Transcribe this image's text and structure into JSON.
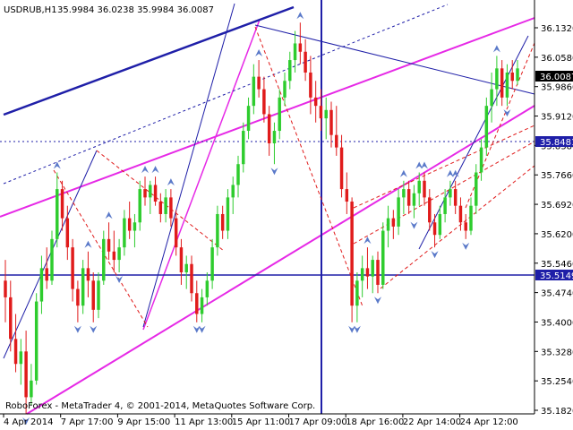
{
  "chart_data": {
    "type": "candlestick",
    "title": "USDRUB,H1",
    "ohlc_header": [
      "35.9984",
      "36.0238",
      "35.9984",
      "36.0087"
    ],
    "credit": "RoboForex - MetaTrader 4, © 2001-2014, MetaQuotes Software Corp.",
    "x_ticks": [
      "4 Apr 2014",
      "7 Apr 17:00",
      "9 Apr 15:00",
      "11 Apr 13:00",
      "15 Apr 11:00",
      "17 Apr 09:00",
      "18 Apr 16:00",
      "22 Apr 14:00",
      "24 Apr 12:00"
    ],
    "y_ticks": [
      "36.1320",
      "36.0580",
      "35.9860",
      "35.9120",
      "35.8380",
      "35.7660",
      "35.6920",
      "35.6200",
      "35.5460",
      "35.4740",
      "35.4000",
      "35.3280",
      "35.2540",
      "35.1820"
    ],
    "ylim": [
      35.18,
      36.17
    ],
    "price_markers": [
      {
        "value": "36.0087",
        "color": "#000000"
      },
      {
        "value": "35.8481",
        "color": "#1f1fa8"
      },
      {
        "value": "35.5149",
        "color": "#1f1fa8"
      }
    ],
    "colors": {
      "bull": "#2ecc2e",
      "bear": "#e01b1b",
      "channel": "#e629e6",
      "trend": "#1f1fa8",
      "fractal": "#5a79c9",
      "grid_dotted": "#1f1fa8"
    },
    "candles": [
      [
        35.5,
        35.55,
        35.4,
        35.46
      ],
      [
        35.46,
        35.5,
        35.33,
        35.36
      ],
      [
        35.36,
        35.42,
        35.28,
        35.3
      ],
      [
        35.3,
        35.36,
        35.25,
        35.33
      ],
      [
        35.33,
        35.38,
        35.18,
        35.22
      ],
      [
        35.22,
        35.3,
        35.2,
        35.26
      ],
      [
        35.26,
        35.47,
        35.25,
        35.45
      ],
      [
        35.45,
        35.56,
        35.42,
        35.53
      ],
      [
        35.53,
        35.58,
        35.48,
        35.5
      ],
      [
        35.5,
        35.62,
        35.49,
        35.6
      ],
      [
        35.6,
        35.76,
        35.58,
        35.72
      ],
      [
        35.72,
        35.74,
        35.62,
        35.65
      ],
      [
        35.65,
        35.68,
        35.55,
        35.58
      ],
      [
        35.58,
        35.6,
        35.45,
        35.48
      ],
      [
        35.48,
        35.5,
        35.4,
        35.44
      ],
      [
        35.44,
        35.55,
        35.42,
        35.53
      ],
      [
        35.53,
        35.57,
        35.46,
        35.5
      ],
      [
        35.5,
        35.52,
        35.4,
        35.43
      ],
      [
        35.43,
        35.52,
        35.41,
        35.5
      ],
      [
        35.5,
        35.62,
        35.49,
        35.6
      ],
      [
        35.6,
        35.64,
        35.55,
        35.57
      ],
      [
        35.57,
        35.62,
        35.52,
        35.55
      ],
      [
        35.55,
        35.6,
        35.52,
        35.58
      ],
      [
        35.58,
        35.67,
        35.56,
        35.65
      ],
      [
        35.65,
        35.69,
        35.6,
        35.62
      ],
      [
        35.62,
        35.66,
        35.58,
        35.64
      ],
      [
        35.64,
        35.74,
        35.62,
        35.72
      ],
      [
        35.72,
        35.75,
        35.68,
        35.7
      ],
      [
        35.7,
        35.74,
        35.66,
        35.73
      ],
      [
        35.73,
        35.75,
        35.68,
        35.69
      ],
      [
        35.69,
        35.71,
        35.64,
        35.66
      ],
      [
        35.66,
        35.72,
        35.64,
        35.7
      ],
      [
        35.7,
        35.72,
        35.63,
        35.65
      ],
      [
        35.65,
        35.67,
        35.56,
        35.58
      ],
      [
        35.58,
        35.6,
        35.49,
        35.52
      ],
      [
        35.52,
        35.56,
        35.48,
        35.54
      ],
      [
        35.54,
        35.56,
        35.45,
        35.47
      ],
      [
        35.47,
        35.5,
        35.4,
        35.42
      ],
      [
        35.42,
        35.48,
        35.4,
        35.46
      ],
      [
        35.46,
        35.52,
        35.44,
        35.5
      ],
      [
        35.5,
        35.6,
        35.48,
        35.58
      ],
      [
        35.58,
        35.68,
        35.56,
        35.66
      ],
      [
        35.66,
        35.68,
        35.6,
        35.62
      ],
      [
        35.62,
        35.72,
        35.6,
        35.7
      ],
      [
        35.7,
        35.75,
        35.66,
        35.73
      ],
      [
        35.73,
        35.8,
        35.7,
        35.78
      ],
      [
        35.78,
        35.88,
        35.76,
        35.86
      ],
      [
        35.86,
        35.94,
        35.84,
        35.92
      ],
      [
        35.92,
        36.02,
        35.9,
        35.99
      ],
      [
        35.99,
        36.03,
        35.94,
        35.96
      ],
      [
        35.96,
        35.99,
        35.88,
        35.9
      ],
      [
        35.9,
        35.92,
        35.8,
        35.83
      ],
      [
        35.83,
        35.88,
        35.78,
        35.86
      ],
      [
        35.86,
        35.96,
        35.84,
        35.94
      ],
      [
        35.94,
        36.0,
        35.92,
        35.98
      ],
      [
        35.98,
        36.05,
        35.96,
        36.03
      ],
      [
        36.03,
        36.1,
        36.0,
        36.07
      ],
      [
        36.07,
        36.12,
        36.02,
        36.05
      ],
      [
        36.05,
        36.08,
        35.98,
        36.0
      ],
      [
        36.0,
        36.04,
        35.9,
        35.94
      ],
      [
        35.94,
        35.98,
        35.88,
        35.92
      ],
      [
        35.92,
        35.96,
        35.86,
        35.89
      ],
      [
        35.89,
        35.94,
        35.84,
        35.91
      ],
      [
        35.91,
        35.93,
        35.82,
        35.85
      ],
      [
        35.85,
        35.92,
        35.8,
        35.82
      ],
      [
        35.82,
        35.85,
        35.7,
        35.72
      ],
      [
        35.72,
        35.76,
        35.66,
        35.69
      ],
      [
        35.69,
        35.7,
        35.4,
        35.44
      ],
      [
        35.44,
        35.52,
        35.4,
        35.5
      ],
      [
        35.5,
        35.56,
        35.46,
        35.53
      ],
      [
        35.53,
        35.58,
        35.48,
        35.51
      ],
      [
        35.51,
        35.56,
        35.47,
        35.55
      ],
      [
        35.55,
        35.57,
        35.47,
        35.49
      ],
      [
        35.49,
        35.64,
        35.48,
        35.62
      ],
      [
        35.62,
        35.68,
        35.58,
        35.65
      ],
      [
        35.65,
        35.67,
        35.6,
        35.63
      ],
      [
        35.63,
        35.72,
        35.61,
        35.7
      ],
      [
        35.7,
        35.74,
        35.66,
        35.72
      ],
      [
        35.72,
        35.74,
        35.66,
        35.68
      ],
      [
        35.68,
        35.73,
        35.65,
        35.71
      ],
      [
        35.71,
        35.76,
        35.68,
        35.74
      ],
      [
        35.74,
        35.76,
        35.68,
        35.7
      ],
      [
        35.7,
        35.72,
        35.62,
        35.64
      ],
      [
        35.64,
        35.66,
        35.58,
        35.61
      ],
      [
        35.61,
        35.68,
        35.6,
        35.66
      ],
      [
        35.66,
        35.72,
        35.64,
        35.7
      ],
      [
        35.7,
        35.74,
        35.68,
        35.72
      ],
      [
        35.72,
        35.74,
        35.66,
        35.68
      ],
      [
        35.68,
        35.7,
        35.62,
        35.64
      ],
      [
        35.64,
        35.66,
        35.6,
        35.62
      ],
      [
        35.62,
        35.7,
        35.61,
        35.68
      ],
      [
        35.68,
        35.78,
        35.66,
        35.76
      ],
      [
        35.76,
        35.84,
        35.74,
        35.82
      ],
      [
        35.82,
        35.94,
        35.8,
        35.92
      ],
      [
        35.92,
        36.0,
        35.88,
        35.96
      ],
      [
        35.96,
        36.04,
        35.92,
        36.01
      ],
      [
        36.01,
        36.03,
        35.92,
        35.94
      ],
      [
        35.94,
        36.02,
        35.92,
        36.0
      ],
      [
        36.0,
        36.03,
        35.96,
        35.98
      ],
      [
        35.98,
        36.03,
        35.97,
        36.01
      ]
    ]
  }
}
